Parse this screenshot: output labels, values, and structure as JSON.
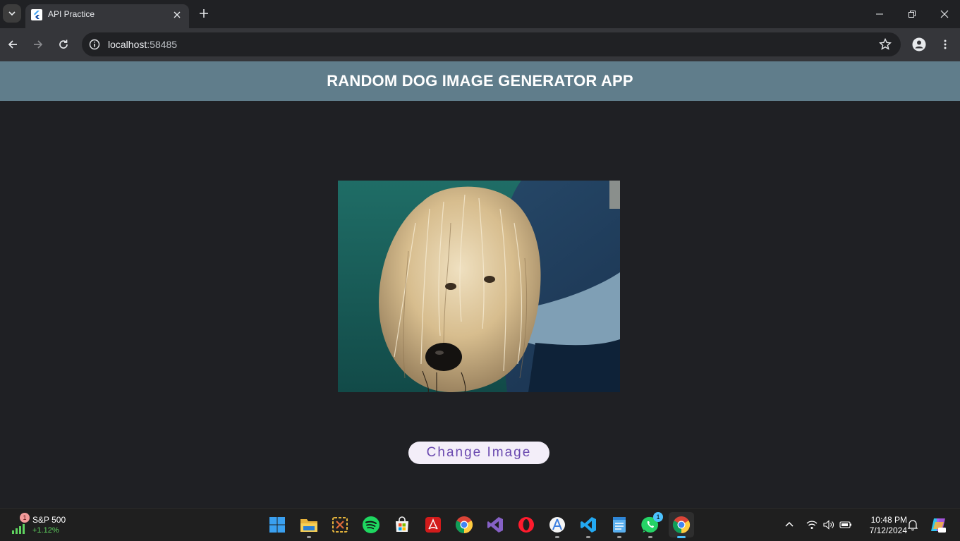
{
  "browser": {
    "tab": {
      "title": "API Practice"
    },
    "address": {
      "host": "localhost",
      "port": ":58485"
    }
  },
  "app": {
    "title": "RANDOM DOG IMAGE GENERATOR APP",
    "button_label": "Change Image"
  },
  "taskbar": {
    "widget": {
      "badge": "1",
      "name": "S&P 500",
      "change": "+1.12%"
    },
    "apps": [
      {
        "name": "start-icon"
      },
      {
        "name": "file-explorer-icon"
      },
      {
        "name": "snipping-tool-icon"
      },
      {
        "name": "spotify-icon"
      },
      {
        "name": "microsoft-store-icon"
      },
      {
        "name": "acrobat-icon"
      },
      {
        "name": "chrome-icon"
      },
      {
        "name": "visual-studio-icon"
      },
      {
        "name": "opera-icon"
      },
      {
        "name": "android-studio-icon"
      },
      {
        "name": "vscode-icon"
      },
      {
        "name": "notepad-icon"
      },
      {
        "name": "whatsapp-icon",
        "badge": "1"
      },
      {
        "name": "chrome-icon"
      }
    ],
    "clock": {
      "time": "10:48 PM",
      "date": "7/12/2024"
    }
  },
  "colors": {
    "appbar": "#607d8b",
    "body": "#1f2024",
    "button_bg": "#f3eef9",
    "button_text": "#6b4ab0"
  }
}
